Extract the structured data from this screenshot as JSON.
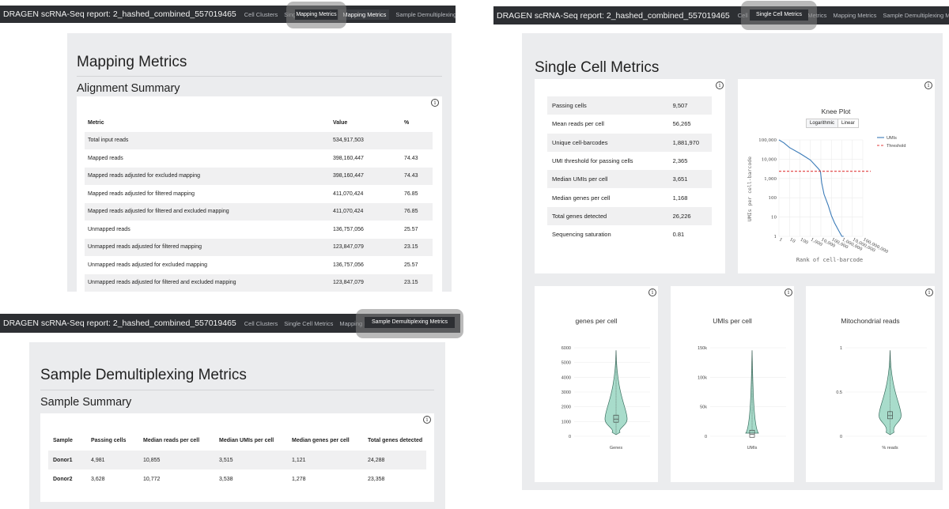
{
  "report_title": "DRAGEN scRNA-Seq report: 2_hashed_combined_557019465",
  "nav_tabs": [
    "Cell Clusters",
    "Single Cell Metrics",
    "Mapping Metrics",
    "Sample Demultiplexing Metrics"
  ],
  "mapping": {
    "title": "Mapping Metrics",
    "subtitle": "Alignment Summary",
    "headers": [
      "Metric",
      "Value",
      "%"
    ],
    "rows": [
      [
        "Total input reads",
        "534,917,503",
        ""
      ],
      [
        "Mapped reads",
        "398,160,447",
        "74.43"
      ],
      [
        "Mapped reads adjusted for excluded mapping",
        "398,160,447",
        "74.43"
      ],
      [
        "Mapped reads adjusted for filtered mapping",
        "411,070,424",
        "76.85"
      ],
      [
        "Mapped reads adjusted for filtered and excluded mapping",
        "411,070,424",
        "76.85"
      ],
      [
        "Unmapped reads",
        "136,757,056",
        "25.57"
      ],
      [
        "Unmapped reads adjusted for filtered mapping",
        "123,847,079",
        "23.15"
      ],
      [
        "Unmapped reads adjusted for excluded mapping",
        "136,757,056",
        "25.57"
      ],
      [
        "Unmapped reads adjusted for filtered and excluded mapping",
        "123,847,079",
        "23.15"
      ]
    ]
  },
  "single_cell": {
    "title": "Single Cell Metrics",
    "rows": [
      [
        "Passing cells",
        "9,507"
      ],
      [
        "Mean reads per cell",
        "56,265"
      ],
      [
        "Unique cell-barcodes",
        "1,881,970"
      ],
      [
        "UMI threshold for passing cells",
        "2,365"
      ],
      [
        "Median UMIs per cell",
        "3,651"
      ],
      [
        "Median genes per cell",
        "1,168"
      ],
      [
        "Total genes detected",
        "26,226"
      ],
      [
        "Sequencing saturation",
        "0.81"
      ]
    ]
  },
  "demux": {
    "title": "Sample Demultiplexing Metrics",
    "subtitle": "Sample Summary",
    "headers": [
      "Sample",
      "Passing cells",
      "Median reads per cell",
      "Median UMIs per cell",
      "Median genes per cell",
      "Total genes detected"
    ],
    "rows": [
      [
        "Donor1",
        "4,981",
        "10,855",
        "3,515",
        "1,121",
        "24,288"
      ],
      [
        "Donor2",
        "3,628",
        "10,772",
        "3,538",
        "1,278",
        "23,358"
      ]
    ]
  },
  "knee": {
    "title": "Knee Plot",
    "btn_log": "Logarithmic",
    "btn_linear": "Linear",
    "ylabel": "UMIs per cell-barcode",
    "xlabel": "Rank of cell-barcode",
    "legend_umis": "UMIs",
    "legend_threshold": "Threshold",
    "y_ticks": [
      "100,000",
      "10,000",
      "1,000",
      "100",
      "10",
      "1"
    ],
    "x_ticks": [
      "1",
      "10",
      "100",
      "1,000",
      "10,000",
      "100,000",
      "1,000,000",
      "10,000,000",
      "100,000,000"
    ],
    "line_color": "#3b7bb8",
    "threshold_color": "#e03b3b"
  },
  "chart_data": [
    {
      "type": "line",
      "title": "Knee Plot",
      "xlabel": "Rank of cell-barcode",
      "ylabel": "UMIs per cell-barcode",
      "x_scale": "log",
      "y_scale": "log",
      "series": [
        {
          "name": "UMIs",
          "x": [
            1,
            3,
            10,
            100,
            1000,
            5000,
            9000,
            12000,
            20000,
            50000,
            100000,
            200000,
            500000,
            1000000,
            1500000
          ],
          "y": [
            100000,
            70000,
            40000,
            20000,
            9000,
            3500,
            2400,
            600,
            150,
            40,
            12,
            5,
            2,
            1,
            1
          ]
        },
        {
          "name": "Threshold",
          "x": [
            1,
            100000000
          ],
          "y": [
            2365,
            2365
          ]
        }
      ]
    },
    {
      "type": "violin",
      "title": "genes per cell",
      "xlabel": "Genes",
      "y_ticks": [
        "0",
        "1000",
        "2000",
        "3000",
        "4000",
        "5000",
        "6000"
      ],
      "ylim": [
        0,
        6000
      ],
      "median": 1168
    },
    {
      "type": "violin",
      "title": "UMIs per cell",
      "xlabel": "UMIs",
      "y_ticks": [
        "0",
        "50k",
        "100k",
        "150k"
      ],
      "ylim": [
        0,
        150000
      ],
      "median": 3651
    },
    {
      "type": "violin",
      "title": "Mitochondrial reads",
      "xlabel": "% reads",
      "y_ticks": [
        "0",
        "0.5",
        "1"
      ],
      "ylim": [
        0,
        1.5
      ],
      "median": 0.35
    }
  ]
}
